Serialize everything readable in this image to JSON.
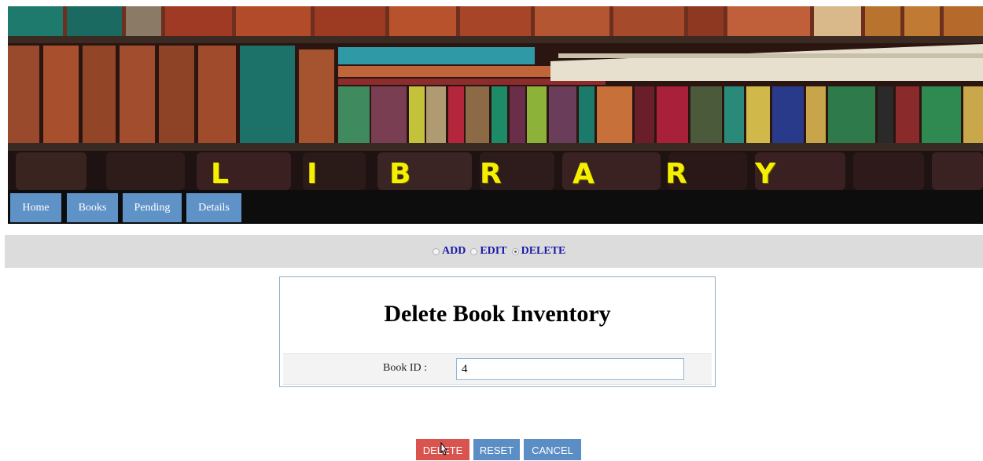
{
  "banner": {
    "letters": [
      "L",
      "I",
      "B",
      "R",
      "A",
      "R",
      "Y"
    ]
  },
  "nav": {
    "items": [
      {
        "label": "Home"
      },
      {
        "label": "Books"
      },
      {
        "label": "Pending"
      },
      {
        "label": "Details"
      }
    ]
  },
  "mode": {
    "options": [
      {
        "label": "ADD",
        "checked": false
      },
      {
        "label": "EDIT",
        "checked": false
      },
      {
        "label": "DELETE",
        "checked": true
      }
    ]
  },
  "form": {
    "title": "Delete Book Inventory",
    "book_id_label": "Book ID :",
    "book_id_value": "4"
  },
  "actions": {
    "delete_label": "DELETE",
    "reset_label": "RESET",
    "cancel_label": "CANCEL"
  },
  "colors": {
    "nav_button": "#5f93c7",
    "delete_button": "#d9534f",
    "secondary_button": "#5b8ec4",
    "banner_text": "#f5f000",
    "radio_label": "#1a1aa6"
  }
}
